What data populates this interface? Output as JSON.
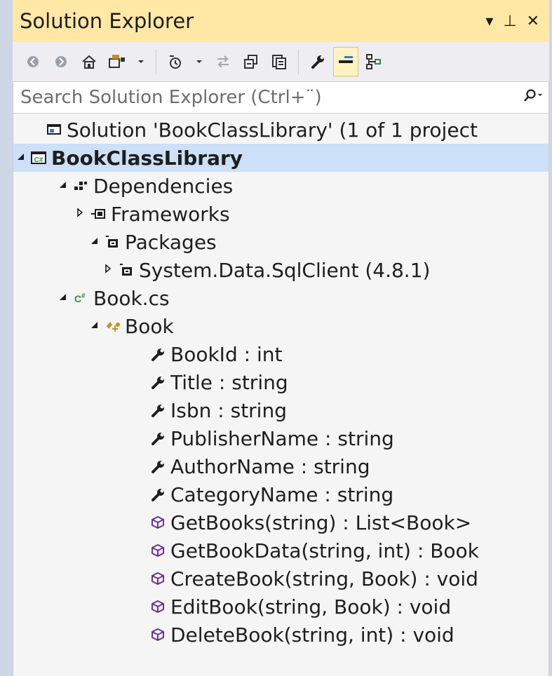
{
  "window": {
    "title": "Solution Explorer"
  },
  "title_buttons": {
    "dropdown": "▾",
    "pin": "⊥",
    "close": "✕"
  },
  "search": {
    "placeholder": "Search Solution Explorer (Ctrl+¨)"
  },
  "tree": [
    {
      "label": "Solution 'BookClassLibrary' (1 of 1 project",
      "icon": "solution-icon",
      "expander": "none"
    },
    {
      "label": "BookClassLibrary",
      "icon": "csharp-project-icon",
      "expander": "expanded",
      "selected": true,
      "bold": true
    },
    {
      "label": "Dependencies",
      "icon": "dependencies-icon",
      "expander": "expanded"
    },
    {
      "label": "Frameworks",
      "icon": "framework-icon",
      "expander": "collapsed"
    },
    {
      "label": "Packages",
      "icon": "package-icon",
      "expander": "expanded"
    },
    {
      "label": "System.Data.SqlClient (4.8.1)",
      "icon": "package-icon",
      "expander": "collapsed"
    },
    {
      "label": "Book.cs",
      "icon": "csharp-file-icon",
      "expander": "expanded"
    },
    {
      "label": "Book",
      "icon": "class-icon",
      "expander": "expanded"
    },
    {
      "label": "BookId : int",
      "icon": "property-icon",
      "expander": "none"
    },
    {
      "label": "Title : string",
      "icon": "property-icon",
      "expander": "none"
    },
    {
      "label": "Isbn : string",
      "icon": "property-icon",
      "expander": "none"
    },
    {
      "label": "PublisherName : string",
      "icon": "property-icon",
      "expander": "none"
    },
    {
      "label": "AuthorName : string",
      "icon": "property-icon",
      "expander": "none"
    },
    {
      "label": "CategoryName : string",
      "icon": "property-icon",
      "expander": "none"
    },
    {
      "label": "GetBooks(string) : List<Book>",
      "icon": "method-icon",
      "expander": "none"
    },
    {
      "label": "GetBookData(string, int) : Book",
      "icon": "method-icon",
      "expander": "none"
    },
    {
      "label": "CreateBook(string, Book) : void",
      "icon": "method-icon",
      "expander": "none"
    },
    {
      "label": "EditBook(string, Book) : void",
      "icon": "method-icon",
      "expander": "none"
    },
    {
      "label": "DeleteBook(string, int) : void",
      "icon": "method-icon",
      "expander": "none"
    }
  ],
  "colors": {
    "title_bar": "#ffe8a6",
    "selected_row": "#cce0f7",
    "panel": "#f5f5f5"
  }
}
